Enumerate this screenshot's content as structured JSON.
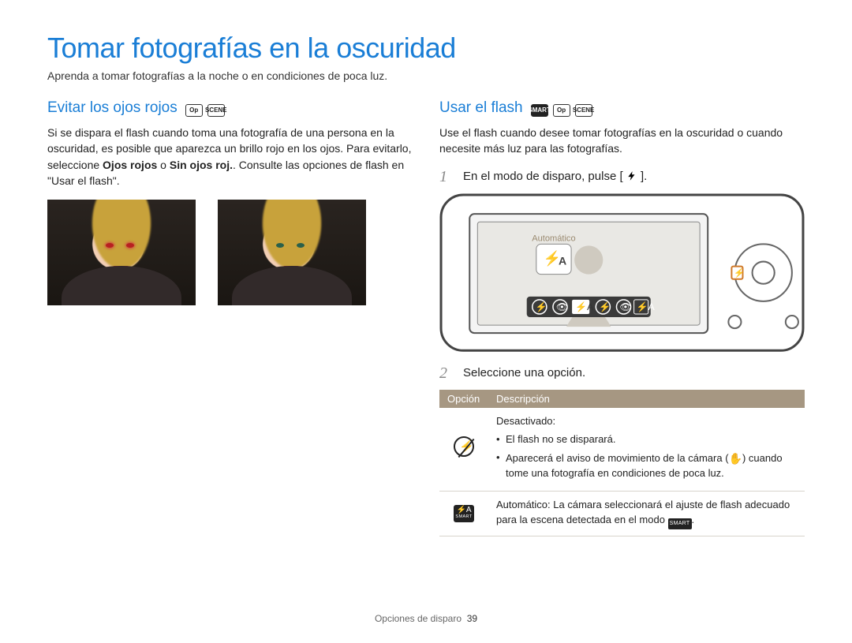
{
  "title": "Tomar fotografías en la oscuridad",
  "lead": "Aprenda a tomar fotografías a la noche o en condiciones de poca luz.",
  "left": {
    "heading": "Evitar los ojos rojos",
    "badges": [
      "Op",
      "SCENE"
    ],
    "p1a": "Si se dispara el flash cuando toma una fotografía de una persona en la oscuridad, es posible que aparezca un brillo rojo en los ojos. Para evitarlo, seleccione ",
    "p1b_strong": "Ojos rojos",
    "p1c": " o ",
    "p1d_strong": "Sin ojos roj.",
    "p1e": ". Consulte las opciones de flash en \"Usar el flash\".",
    "photo_labels": [
      "red-eye-example",
      "corrected-example"
    ]
  },
  "right": {
    "heading": "Usar el flash",
    "badges": [
      "SMART",
      "Op",
      "SCENE"
    ],
    "intro": "Use el flash cuando desee tomar fotografías en la oscuridad o cuando necesite más luz para las fotografías.",
    "step1_num": "1",
    "step1_text_a": "En el modo de disparo, pulse [",
    "step1_text_b": "].",
    "camera_screen_label": "Automático",
    "step2_num": "2",
    "step2_text": "Seleccione una opción.",
    "table": {
      "head_option": "Opción",
      "head_desc": "Descripción",
      "row1": {
        "title": "Desactivado",
        "b1": "El flash no se disparará.",
        "b2a": "Aparecerá el aviso de movimiento de la cámara (",
        "b2b": ") cuando tome una fotografía en condiciones de poca luz."
      },
      "row2": {
        "title": "Automático",
        "rest_a": ": La cámara seleccionará el ajuste de flash adecuado para la escena detectada en el modo ",
        "rest_b": "."
      }
    }
  },
  "footer_section": "Opciones de disparo",
  "footer_page": "39",
  "chart_data": {
    "type": "table",
    "title": "Opciones de flash",
    "columns": [
      "Opción",
      "Descripción"
    ],
    "rows": [
      {
        "Opción": "Desactivado (flash off)",
        "Descripción": "El flash no se disparará. Aparecerá el aviso de movimiento de la cámara cuando tome una fotografía en condiciones de poca luz."
      },
      {
        "Opción": "Automático (Smart)",
        "Descripción": "La cámara seleccionará el ajuste de flash adecuado para la escena detectada en el modo SMART."
      }
    ]
  }
}
